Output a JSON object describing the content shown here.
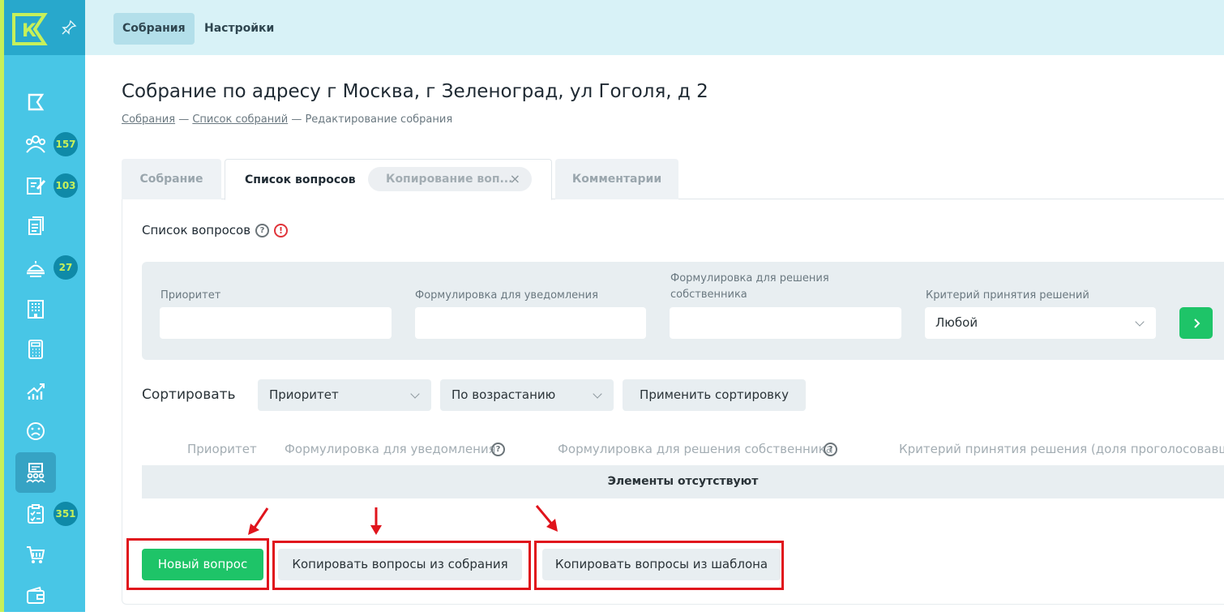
{
  "sidebar": {
    "logo_letter": "К",
    "badges": [
      "157",
      "103",
      "27",
      "351"
    ]
  },
  "topbar": {
    "tabs": [
      {
        "label": "Собрания",
        "active": true
      },
      {
        "label": "Настройки",
        "active": false
      }
    ]
  },
  "page": {
    "title": "Собрание по адресу г Москва, г Зеленоград, ул Гоголя, д 2",
    "breadcrumb": {
      "link1": "Собрания",
      "sep": "—",
      "link2": "Список собраний",
      "current": "Редактирование собрания"
    }
  },
  "tabs": {
    "t1": "Собрание",
    "t2": "Список вопросов",
    "t3": "Копирование воп...",
    "t3_close": "×",
    "t4": "Комментарии"
  },
  "questions": {
    "title": "Список вопросов",
    "help": "?",
    "warn": "!"
  },
  "filters": {
    "priority_label": "Приоритет",
    "notice_label": "Формулировка для уведомления",
    "owner_label": "Формулировка для решения собственника",
    "criterion_label": "Критерий принятия решений",
    "criterion_value": "Любой"
  },
  "sort": {
    "label": "Сортировать",
    "field": "Приоритет",
    "order": "По возрастанию",
    "apply": "Применить сортировку"
  },
  "table": {
    "headers": [
      "Приоритет",
      "Формулировка для уведомления",
      "Формулировка для решения собственника",
      "Критерий принятия решения (доля проголосовавших"
    ],
    "empty": "Элементы отсутствуют"
  },
  "actions": {
    "new": "Новый вопрос",
    "copy_meeting": "Копировать вопросы из собрания",
    "copy_template": "Копировать вопросы из шаблона"
  },
  "colors": {
    "sidebar": "#48c6e6",
    "accent_green": "#1ec468",
    "highlight_red": "#e0141c",
    "logo_lime": "#c6f05a"
  }
}
